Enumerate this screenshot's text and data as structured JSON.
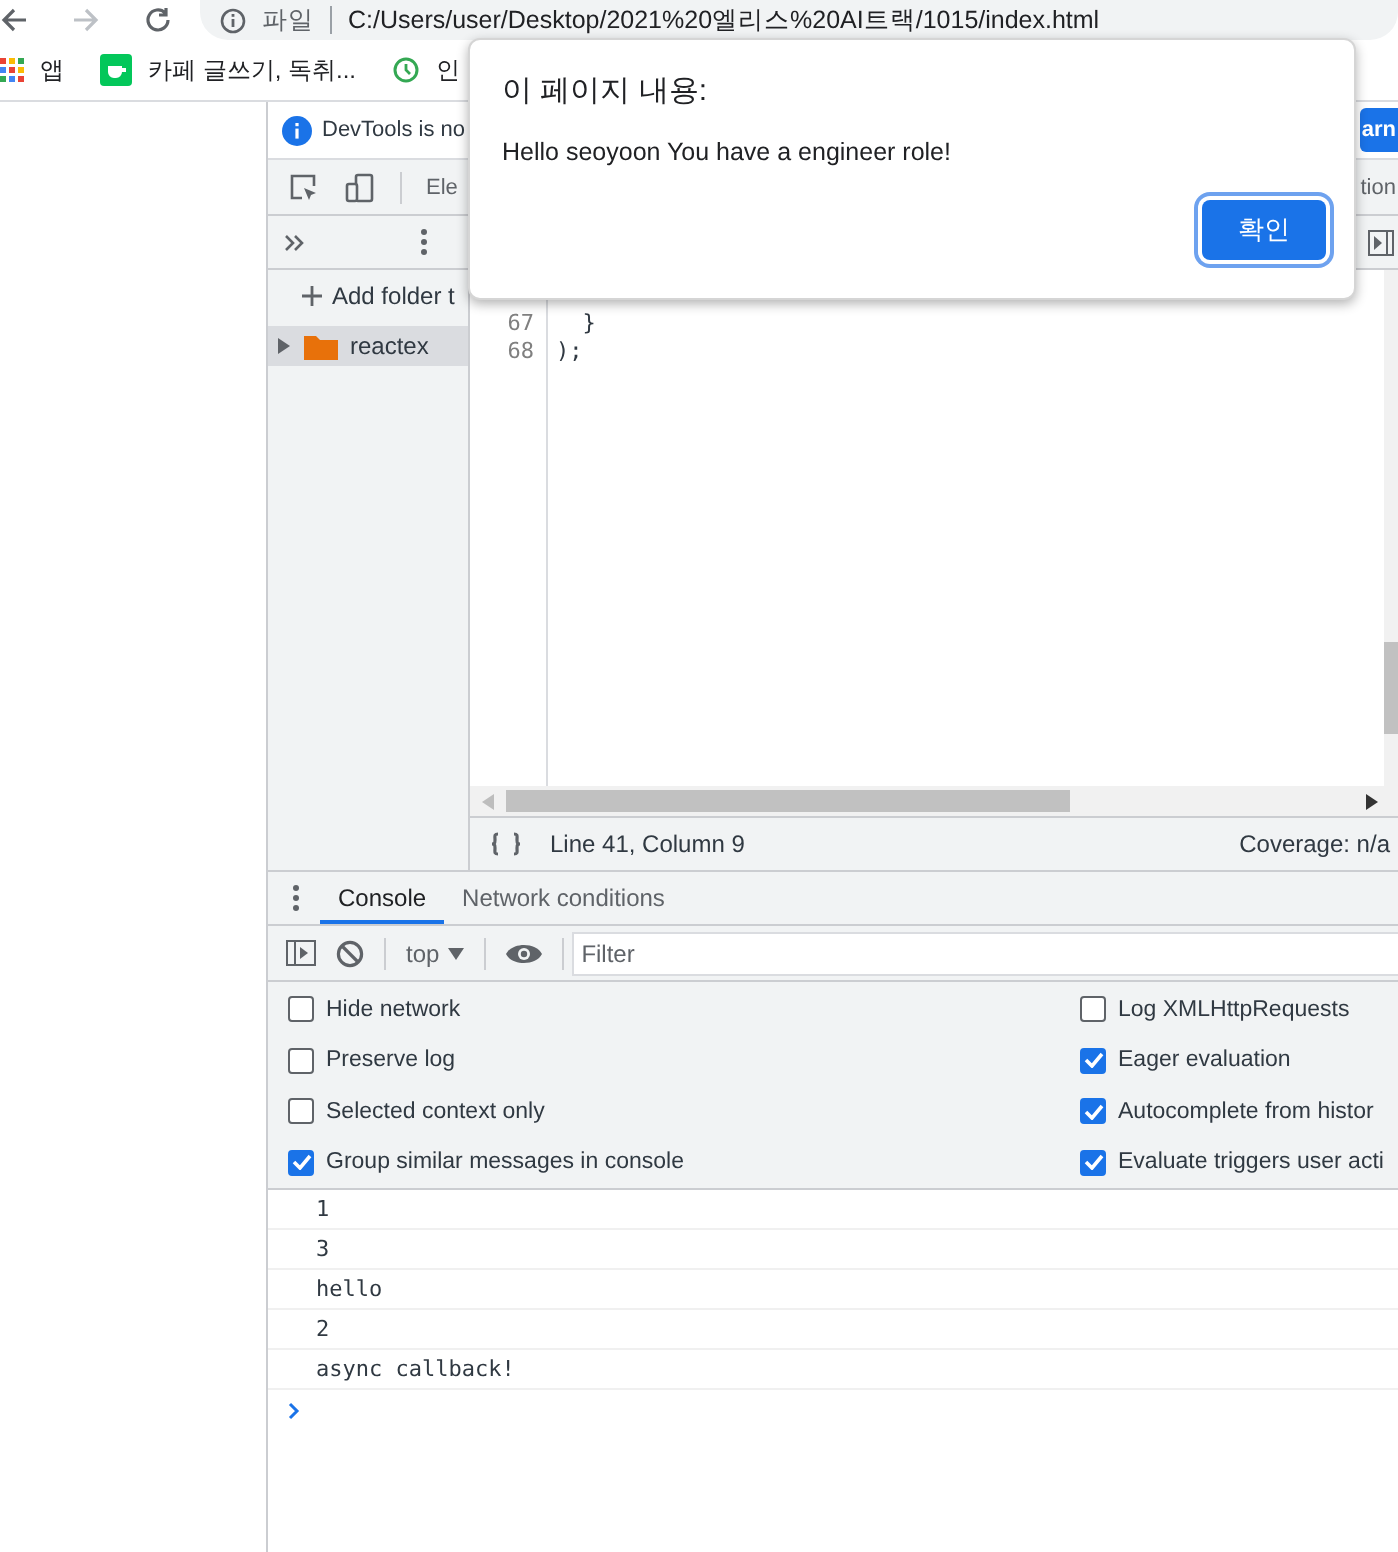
{
  "browser": {
    "address_bar": {
      "scheme": "파일",
      "url": "C:/Users/user/Desktop/2021%20엘리스%20AI트랙/1015/index.html"
    },
    "bookmarks": [
      {
        "label": "앱",
        "kind": "apps"
      },
      {
        "label": "카페 글쓰기, 독취...",
        "kind": "cafe"
      },
      {
        "label": "인",
        "kind": "clock"
      }
    ]
  },
  "alert_dialog": {
    "title": "이 페이지 내용:",
    "message": "Hello seoyoon You have a engineer role!",
    "button": "확인"
  },
  "devtools": {
    "info_bar": {
      "message": "DevTools is no",
      "button": "arn"
    },
    "main_tabs": [
      "Ele",
      "tion"
    ],
    "navigator": {
      "add_folder": "Add folder t",
      "tree": [
        {
          "label": "reactex",
          "expanded": false
        }
      ]
    },
    "editor": {
      "lines": [
        {
          "number": "67",
          "code": "  }"
        },
        {
          "number": "68",
          "code": ");"
        }
      ]
    },
    "status_bar": {
      "position": "Line 41, Column 9",
      "coverage": "Coverage: n/a"
    },
    "drawer_tabs": [
      {
        "label": "Console",
        "selected": true
      },
      {
        "label": "Network conditions",
        "selected": false
      }
    ],
    "console_toolbar": {
      "context": "top",
      "filter_placeholder": "Filter"
    },
    "settings_left": [
      {
        "label": "Hide network",
        "checked": false
      },
      {
        "label": "Preserve log",
        "checked": false
      },
      {
        "label": "Selected context only",
        "checked": false
      },
      {
        "label": "Group similar messages in console",
        "checked": true
      }
    ],
    "settings_right": [
      {
        "label": "Log XMLHttpRequests",
        "checked": false
      },
      {
        "label": "Eager evaluation",
        "checked": true
      },
      {
        "label": "Autocomplete from histor",
        "checked": true
      },
      {
        "label": "Evaluate triggers user acti",
        "checked": true
      }
    ],
    "messages": [
      "1",
      "3",
      "hello",
      "2",
      "async callback!"
    ]
  }
}
